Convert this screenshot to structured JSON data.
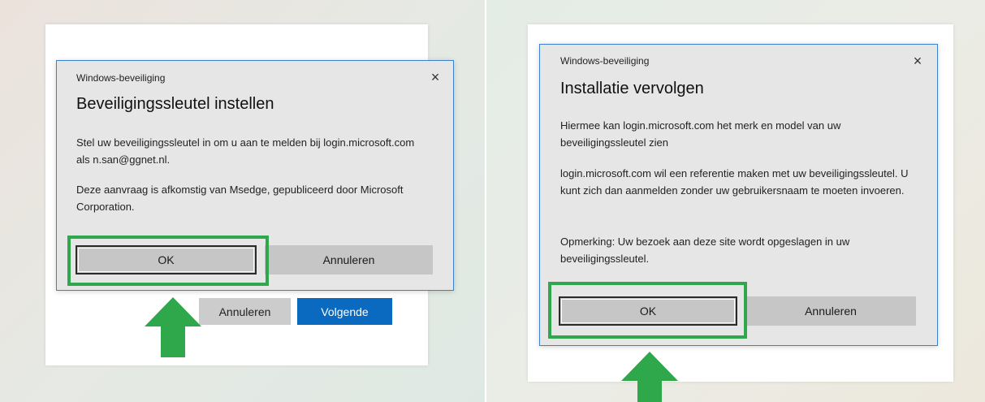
{
  "left": {
    "background_buttons": {
      "cancel_label": "Annuleren",
      "next_label": "Volgende"
    },
    "dialog": {
      "app_name": "Windows-beveiliging",
      "close_glyph": "×",
      "title": "Beveiligingssleutel instellen",
      "paragraphs": [
        "Stel uw beveiligingssleutel in om u aan te melden bij login.microsoft.com als n.san@ggnet.nl.",
        "Deze aanvraag is afkomstig van Msedge, gepubliceerd door Microsoft Corporation."
      ],
      "ok_label": "OK",
      "cancel_label": "Annuleren"
    }
  },
  "right": {
    "dialog": {
      "app_name": "Windows-beveiliging",
      "close_glyph": "×",
      "title": "Installatie vervolgen",
      "paragraphs": [
        "Hiermee kan login.microsoft.com het merk en model van uw beveiligingssleutel zien",
        "login.microsoft.com wil een referentie maken met uw beveiligingssleutel. U kunt zich dan aanmelden zonder uw gebruikersnaam te moeten invoeren.",
        "Opmerking: Uw bezoek aan deze site wordt opgeslagen in uw beveiligingssleutel."
      ],
      "ok_label": "OK",
      "cancel_label": "Annuleren"
    }
  },
  "colors": {
    "highlight": "#2ea84a",
    "arrow": "#2ea84a",
    "primary_button": "#0a6abf",
    "dialog_border": "#3c82cc"
  },
  "icons": {
    "close": "close-icon",
    "pointer": "up-arrow-icon"
  }
}
